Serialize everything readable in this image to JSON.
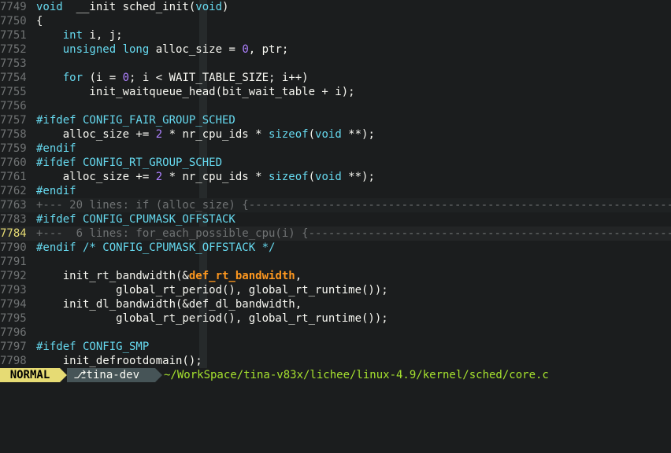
{
  "lines": [
    {
      "num": "7749",
      "cls": "",
      "segs": [
        [
          "kw",
          "void"
        ],
        [
          "",
          "  __init sched_init("
        ],
        [
          "kw",
          "void"
        ],
        [
          "",
          ")"
        ]
      ]
    },
    {
      "num": "7750",
      "cls": "",
      "segs": [
        [
          "",
          "{"
        ]
      ]
    },
    {
      "num": "7751",
      "cls": "",
      "segs": [
        [
          "",
          "    "
        ],
        [
          "kw",
          "int"
        ],
        [
          "",
          " i, j;"
        ]
      ]
    },
    {
      "num": "7752",
      "cls": "",
      "segs": [
        [
          "",
          "    "
        ],
        [
          "kw",
          "unsigned long"
        ],
        [
          "",
          " alloc_size = "
        ],
        [
          "num",
          "0"
        ],
        [
          "",
          ", ptr;"
        ]
      ]
    },
    {
      "num": "7753",
      "cls": "",
      "segs": []
    },
    {
      "num": "7754",
      "cls": "",
      "segs": [
        [
          "",
          "    "
        ],
        [
          "kw",
          "for"
        ],
        [
          "",
          " (i = "
        ],
        [
          "num",
          "0"
        ],
        [
          "",
          "; i < WAIT_TABLE_SIZE; i++)"
        ]
      ]
    },
    {
      "num": "7755",
      "cls": "",
      "segs": [
        [
          "",
          "        init_waitqueue_head(bit_wait_table + i);"
        ]
      ]
    },
    {
      "num": "7756",
      "cls": "",
      "segs": []
    },
    {
      "num": "7757",
      "cls": "",
      "segs": [
        [
          "pp",
          "#ifdef CONFIG_FAIR_GROUP_SCHED"
        ]
      ]
    },
    {
      "num": "7758",
      "cls": "",
      "segs": [
        [
          "",
          "    alloc_size += "
        ],
        [
          "num",
          "2"
        ],
        [
          "",
          " * nr_cpu_ids * "
        ],
        [
          "kw",
          "sizeof"
        ],
        [
          "",
          "("
        ],
        [
          "kw",
          "void"
        ],
        [
          "",
          " **);"
        ]
      ]
    },
    {
      "num": "7759",
      "cls": "",
      "segs": [
        [
          "pp",
          "#endif"
        ]
      ]
    },
    {
      "num": "7760",
      "cls": "",
      "segs": [
        [
          "pp",
          "#ifdef CONFIG_RT_GROUP_SCHED"
        ]
      ]
    },
    {
      "num": "7761",
      "cls": "",
      "segs": [
        [
          "",
          "    alloc_size += "
        ],
        [
          "num",
          "2"
        ],
        [
          "",
          " * nr_cpu_ids * "
        ],
        [
          "kw",
          "sizeof"
        ],
        [
          "",
          "("
        ],
        [
          "kw",
          "void"
        ],
        [
          "",
          " **);"
        ]
      ]
    },
    {
      "num": "7762",
      "cls": "",
      "segs": [
        [
          "pp",
          "#endif"
        ]
      ]
    },
    {
      "num": "7763",
      "cls": "fold",
      "segs": [
        [
          "",
          "+--- 20 lines: if (alloc_size) {------------------------------------------------------------------"
        ]
      ]
    },
    {
      "num": "7783",
      "cls": "",
      "segs": [
        [
          "pp",
          "#ifdef CONFIG_CPUMASK_OFFSTACK"
        ]
      ]
    },
    {
      "num": "7784",
      "cls": "fold cur",
      "segs": [
        [
          "",
          "+---  6 lines: for_each_possible_cpu(i) {---------------------------------------------------------"
        ]
      ]
    },
    {
      "num": "7790",
      "cls": "",
      "segs": [
        [
          "pp",
          "#endif /* CONFIG_CPUMASK_OFFSTACK */"
        ]
      ]
    },
    {
      "num": "7791",
      "cls": "",
      "segs": []
    },
    {
      "num": "7792",
      "cls": "",
      "segs": [
        [
          "",
          "    init_rt_bandwidth(&"
        ],
        [
          "hl",
          "def_rt_bandwidth"
        ],
        [
          "",
          ","
        ]
      ]
    },
    {
      "num": "7793",
      "cls": "",
      "segs": [
        [
          "",
          "            global_rt_period(), global_rt_runtime());"
        ]
      ]
    },
    {
      "num": "7794",
      "cls": "",
      "segs": [
        [
          "",
          "    init_dl_bandwidth(&def_dl_bandwidth,"
        ]
      ]
    },
    {
      "num": "7795",
      "cls": "",
      "segs": [
        [
          "",
          "            global_rt_period(), global_rt_runtime());"
        ]
      ]
    },
    {
      "num": "7796",
      "cls": "",
      "segs": []
    },
    {
      "num": "7797",
      "cls": "",
      "segs": [
        [
          "pp",
          "#ifdef CONFIG_SMP"
        ]
      ]
    },
    {
      "num": "7798",
      "cls": "",
      "segs": [
        [
          "",
          "    init_defrootdomain();"
        ]
      ]
    }
  ],
  "status": {
    "mode": "NORMAL",
    "branch": " ⎇tina-dev",
    "path": "~/WorkSpace/tina-v83x/lichee/linux-4.9/kernel/sched/core.c"
  }
}
